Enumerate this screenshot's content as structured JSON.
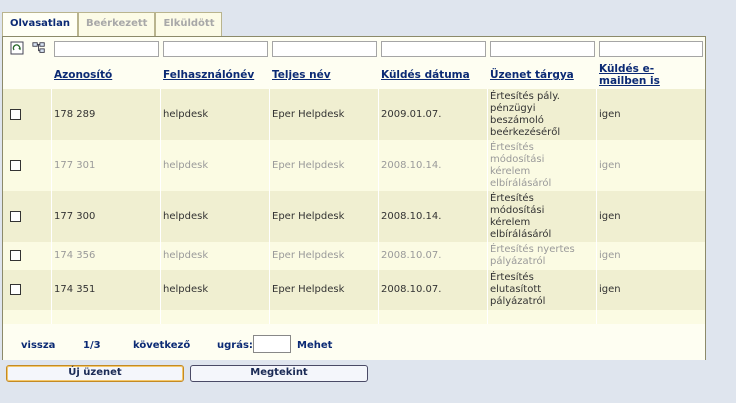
{
  "tabs": [
    {
      "label": "Olvasatlan"
    },
    {
      "label": "Beérkezett"
    },
    {
      "label": "Elküldött"
    }
  ],
  "columns": [
    "Azonosító",
    "Felhasználónév",
    "Teljes név",
    "Küldés dátuma",
    "Üzenet tárgya",
    "Küldés e-mailben is"
  ],
  "rows": [
    {
      "id": "178 289",
      "user": "helpdesk",
      "name": "Eper Helpdesk",
      "date": "2009.01.07.",
      "subject": [
        "Értesítés pály.",
        "pénzügyi",
        "beszámoló",
        "beérkezéséről"
      ],
      "email": "igen",
      "read": false
    },
    {
      "id": "177 301",
      "user": "helpdesk",
      "name": "Eper Helpdesk",
      "date": "2008.10.14.",
      "subject": [
        "Értesítés",
        "módosítási",
        "kérelem",
        "elbírálásáról"
      ],
      "email": "igen",
      "read": true
    },
    {
      "id": "177 300",
      "user": "helpdesk",
      "name": "Eper Helpdesk",
      "date": "2008.10.14.",
      "subject": [
        "Értesítés",
        "módosítási",
        "kérelem",
        "elbírálásáról"
      ],
      "email": "igen",
      "read": false
    },
    {
      "id": "174 356",
      "user": "helpdesk",
      "name": "Eper Helpdesk",
      "date": "2008.10.07.",
      "subject": [
        "Értesítés nyertes",
        "pályázatról"
      ],
      "email": "igen",
      "read": true
    },
    {
      "id": "174 351",
      "user": "helpdesk",
      "name": "Eper Helpdesk",
      "date": "2008.10.07.",
      "subject": [
        "Értesítés",
        "elutasított",
        "pályázatról"
      ],
      "email": "igen",
      "read": false
    }
  ],
  "pager": {
    "back": "vissza",
    "page": "1/3",
    "next": "következő",
    "goto_label": "ugrás:",
    "go": "Mehet"
  },
  "buttons": {
    "new_message": "Új üzenet",
    "view": "Megtekint"
  },
  "icons": {
    "refresh": "refresh-icon",
    "tree": "tree-icon"
  }
}
